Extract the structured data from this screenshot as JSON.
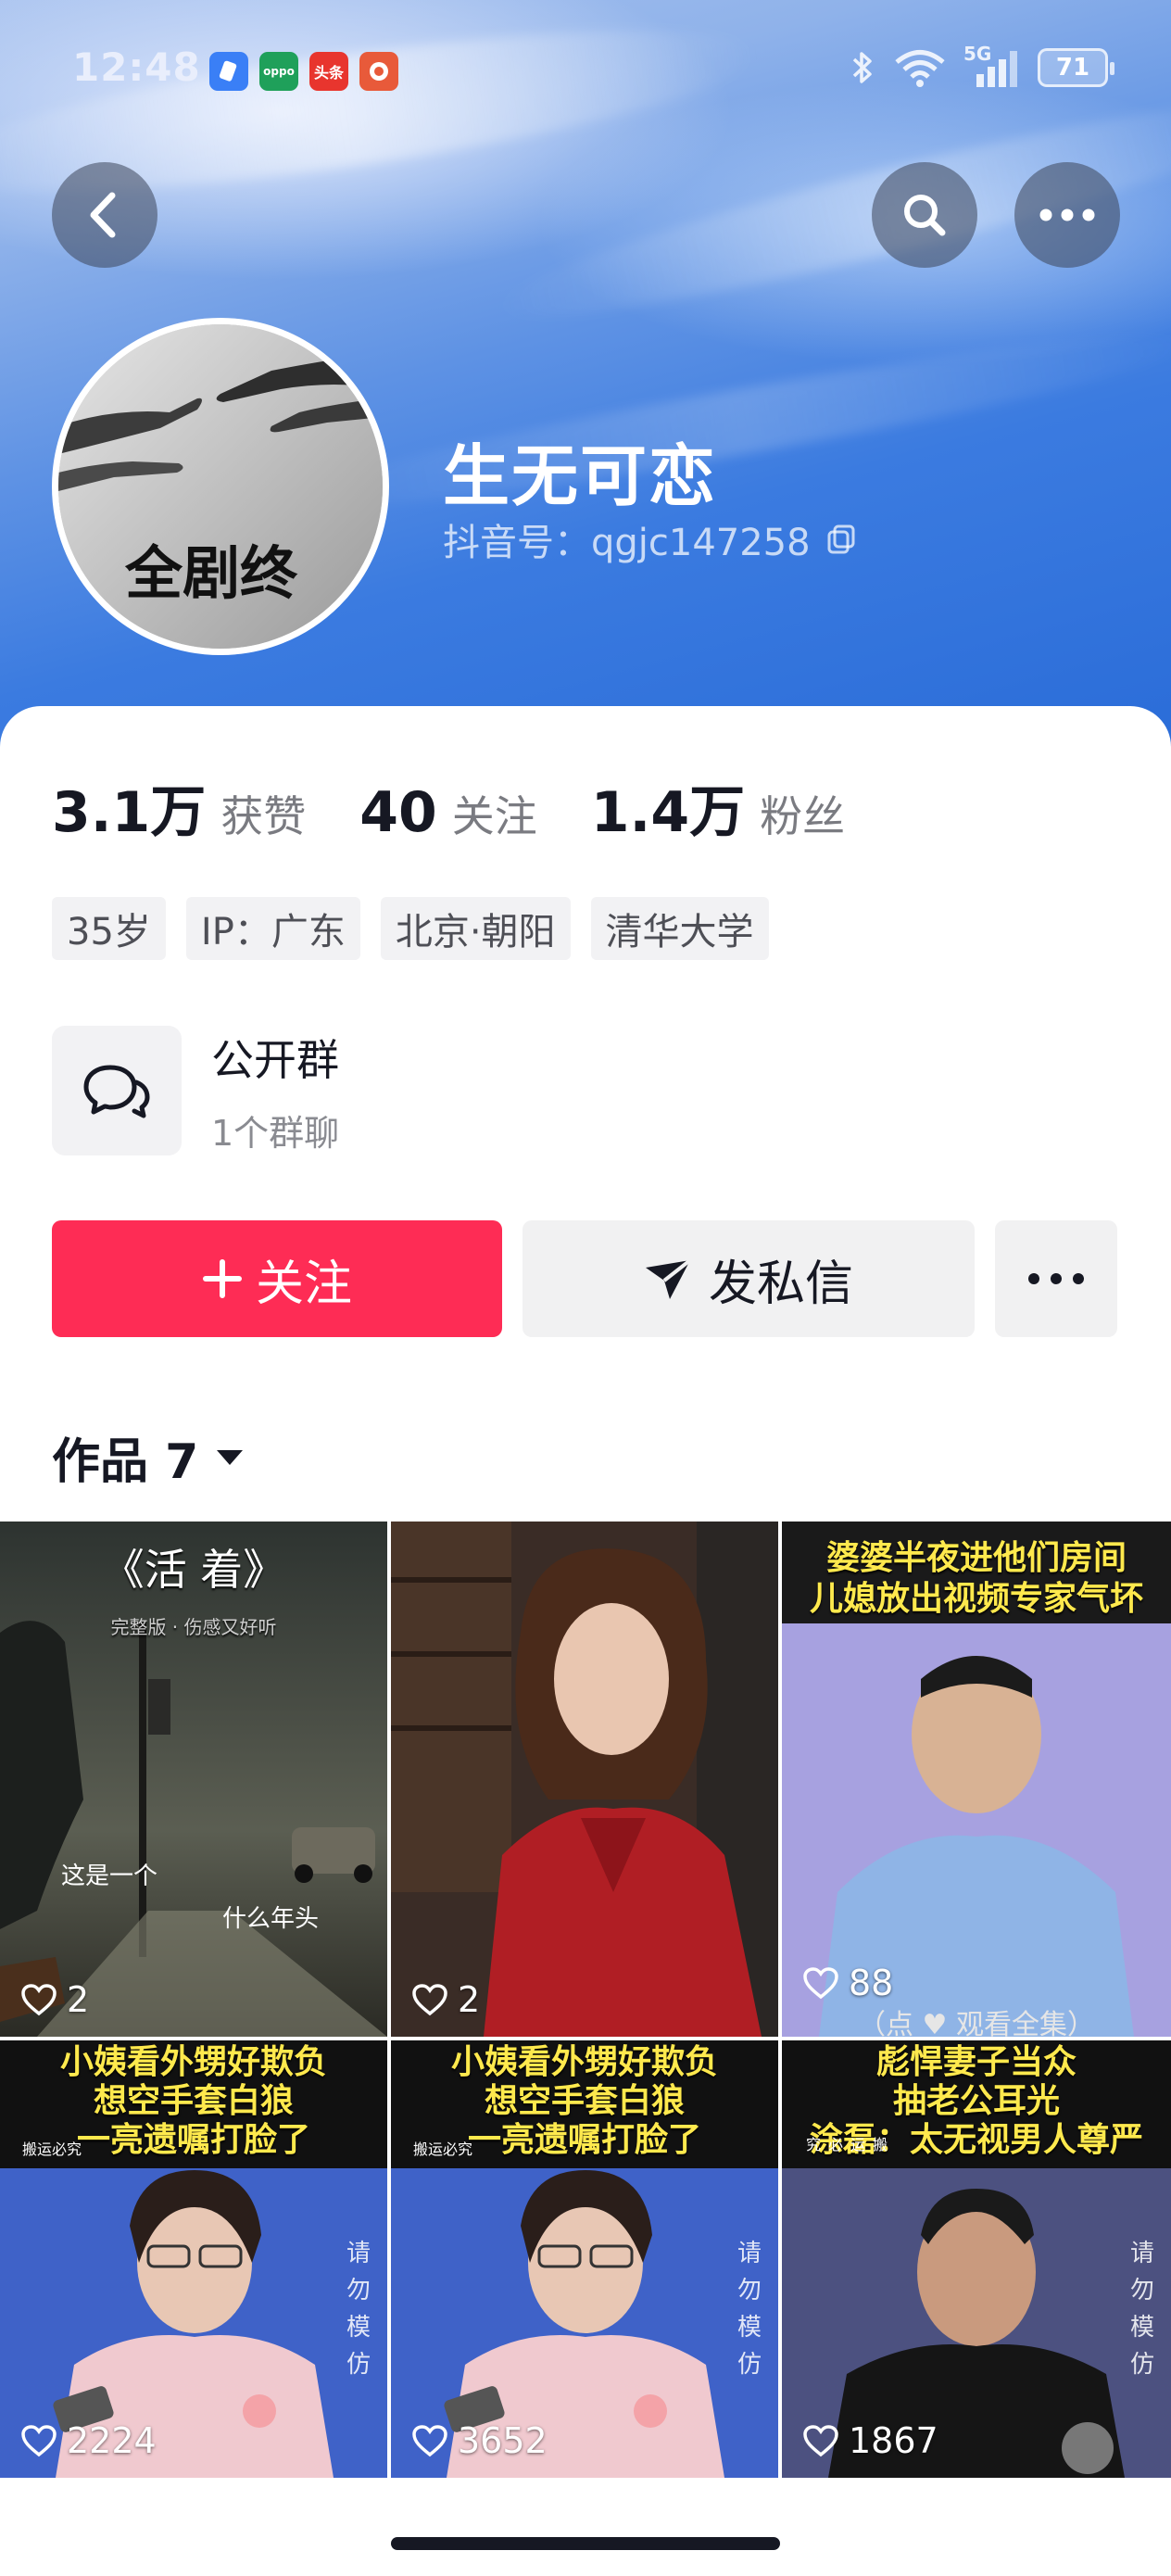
{
  "status_bar": {
    "time": "12:48",
    "apps": [
      {
        "name": "app-icon-1",
        "label": "",
        "color": "#3a7ff6"
      },
      {
        "name": "oppo-app-icon",
        "label": "oppo",
        "color": "#1fa05a"
      },
      {
        "name": "toutiao-app-icon",
        "label": "头条",
        "color": "#e8352e"
      },
      {
        "name": "game-app-icon",
        "label": "",
        "color": "#e85a3a"
      }
    ],
    "network": "5G",
    "battery": "71"
  },
  "profile": {
    "nickname": "生无可恋",
    "douyin_id": "抖音号：qgjc147258",
    "avatar_caption": "全剧终"
  },
  "stats": [
    {
      "value": "3.1万",
      "label": "获赞"
    },
    {
      "value": "40",
      "label": "关注"
    },
    {
      "value": "1.4万",
      "label": "粉丝"
    }
  ],
  "tags": [
    "35岁",
    "IP：广东",
    "北京·朝阳",
    "清华大学"
  ],
  "group": {
    "title": "公开群",
    "subtitle": "1个群聊"
  },
  "actions": {
    "follow": "关注",
    "message": "发私信"
  },
  "works": {
    "label": "作品 7"
  },
  "videos": [
    {
      "likes": "2",
      "title": "《活 着》",
      "subtitle": "完整版 · 伤感又好听",
      "sub1": "这是一个",
      "sub2": "什么年头"
    },
    {
      "likes": "2"
    },
    {
      "likes": "88",
      "cap1": "婆婆半夜进他们房间",
      "cap2": "儿媳放出视频专家气坏",
      "footer": "（点 ♥ 观看全集）"
    },
    {
      "likes": "2224",
      "cap1": "小姨看外甥好欺负",
      "cap2": "想空手套白狼",
      "cap3": "一亮遗嘱打脸了",
      "tag": "搬运必究",
      "side": "请勿模仿"
    },
    {
      "likes": "3652",
      "cap1": "小姨看外甥好欺负",
      "cap2": "想空手套白狼",
      "cap3": "一亮遗嘱打脸了",
      "tag": "搬运必究",
      "side": "请勿模仿"
    },
    {
      "likes": "1867",
      "cap1": "彪悍妻子当众",
      "cap2": "抽老公耳光",
      "cap3": "涂磊：太无视男人尊严",
      "tag": "搬运必究",
      "side": "请勿模仿"
    }
  ]
}
